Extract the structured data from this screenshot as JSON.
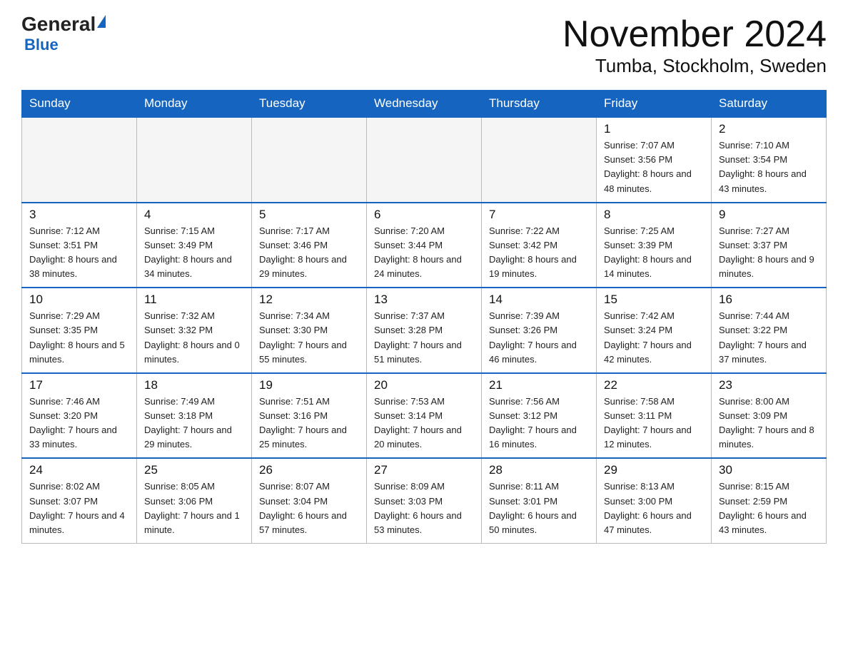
{
  "header": {
    "logo_general": "General",
    "logo_blue": "Blue",
    "month_title": "November 2024",
    "location": "Tumba, Stockholm, Sweden"
  },
  "weekdays": [
    "Sunday",
    "Monday",
    "Tuesday",
    "Wednesday",
    "Thursday",
    "Friday",
    "Saturday"
  ],
  "rows": [
    [
      {
        "day": "",
        "empty": true
      },
      {
        "day": "",
        "empty": true
      },
      {
        "day": "",
        "empty": true
      },
      {
        "day": "",
        "empty": true
      },
      {
        "day": "",
        "empty": true
      },
      {
        "day": "1",
        "sunrise": "7:07 AM",
        "sunset": "3:56 PM",
        "daylight": "8 hours and 48 minutes."
      },
      {
        "day": "2",
        "sunrise": "7:10 AM",
        "sunset": "3:54 PM",
        "daylight": "8 hours and 43 minutes."
      }
    ],
    [
      {
        "day": "3",
        "sunrise": "7:12 AM",
        "sunset": "3:51 PM",
        "daylight": "8 hours and 38 minutes."
      },
      {
        "day": "4",
        "sunrise": "7:15 AM",
        "sunset": "3:49 PM",
        "daylight": "8 hours and 34 minutes."
      },
      {
        "day": "5",
        "sunrise": "7:17 AM",
        "sunset": "3:46 PM",
        "daylight": "8 hours and 29 minutes."
      },
      {
        "day": "6",
        "sunrise": "7:20 AM",
        "sunset": "3:44 PM",
        "daylight": "8 hours and 24 minutes."
      },
      {
        "day": "7",
        "sunrise": "7:22 AM",
        "sunset": "3:42 PM",
        "daylight": "8 hours and 19 minutes."
      },
      {
        "day": "8",
        "sunrise": "7:25 AM",
        "sunset": "3:39 PM",
        "daylight": "8 hours and 14 minutes."
      },
      {
        "day": "9",
        "sunrise": "7:27 AM",
        "sunset": "3:37 PM",
        "daylight": "8 hours and 9 minutes."
      }
    ],
    [
      {
        "day": "10",
        "sunrise": "7:29 AM",
        "sunset": "3:35 PM",
        "daylight": "8 hours and 5 minutes."
      },
      {
        "day": "11",
        "sunrise": "7:32 AM",
        "sunset": "3:32 PM",
        "daylight": "8 hours and 0 minutes."
      },
      {
        "day": "12",
        "sunrise": "7:34 AM",
        "sunset": "3:30 PM",
        "daylight": "7 hours and 55 minutes."
      },
      {
        "day": "13",
        "sunrise": "7:37 AM",
        "sunset": "3:28 PM",
        "daylight": "7 hours and 51 minutes."
      },
      {
        "day": "14",
        "sunrise": "7:39 AM",
        "sunset": "3:26 PM",
        "daylight": "7 hours and 46 minutes."
      },
      {
        "day": "15",
        "sunrise": "7:42 AM",
        "sunset": "3:24 PM",
        "daylight": "7 hours and 42 minutes."
      },
      {
        "day": "16",
        "sunrise": "7:44 AM",
        "sunset": "3:22 PM",
        "daylight": "7 hours and 37 minutes."
      }
    ],
    [
      {
        "day": "17",
        "sunrise": "7:46 AM",
        "sunset": "3:20 PM",
        "daylight": "7 hours and 33 minutes."
      },
      {
        "day": "18",
        "sunrise": "7:49 AM",
        "sunset": "3:18 PM",
        "daylight": "7 hours and 29 minutes."
      },
      {
        "day": "19",
        "sunrise": "7:51 AM",
        "sunset": "3:16 PM",
        "daylight": "7 hours and 25 minutes."
      },
      {
        "day": "20",
        "sunrise": "7:53 AM",
        "sunset": "3:14 PM",
        "daylight": "7 hours and 20 minutes."
      },
      {
        "day": "21",
        "sunrise": "7:56 AM",
        "sunset": "3:12 PM",
        "daylight": "7 hours and 16 minutes."
      },
      {
        "day": "22",
        "sunrise": "7:58 AM",
        "sunset": "3:11 PM",
        "daylight": "7 hours and 12 minutes."
      },
      {
        "day": "23",
        "sunrise": "8:00 AM",
        "sunset": "3:09 PM",
        "daylight": "7 hours and 8 minutes."
      }
    ],
    [
      {
        "day": "24",
        "sunrise": "8:02 AM",
        "sunset": "3:07 PM",
        "daylight": "7 hours and 4 minutes."
      },
      {
        "day": "25",
        "sunrise": "8:05 AM",
        "sunset": "3:06 PM",
        "daylight": "7 hours and 1 minute."
      },
      {
        "day": "26",
        "sunrise": "8:07 AM",
        "sunset": "3:04 PM",
        "daylight": "6 hours and 57 minutes."
      },
      {
        "day": "27",
        "sunrise": "8:09 AM",
        "sunset": "3:03 PM",
        "daylight": "6 hours and 53 minutes."
      },
      {
        "day": "28",
        "sunrise": "8:11 AM",
        "sunset": "3:01 PM",
        "daylight": "6 hours and 50 minutes."
      },
      {
        "day": "29",
        "sunrise": "8:13 AM",
        "sunset": "3:00 PM",
        "daylight": "6 hours and 47 minutes."
      },
      {
        "day": "30",
        "sunrise": "8:15 AM",
        "sunset": "2:59 PM",
        "daylight": "6 hours and 43 minutes."
      }
    ]
  ]
}
